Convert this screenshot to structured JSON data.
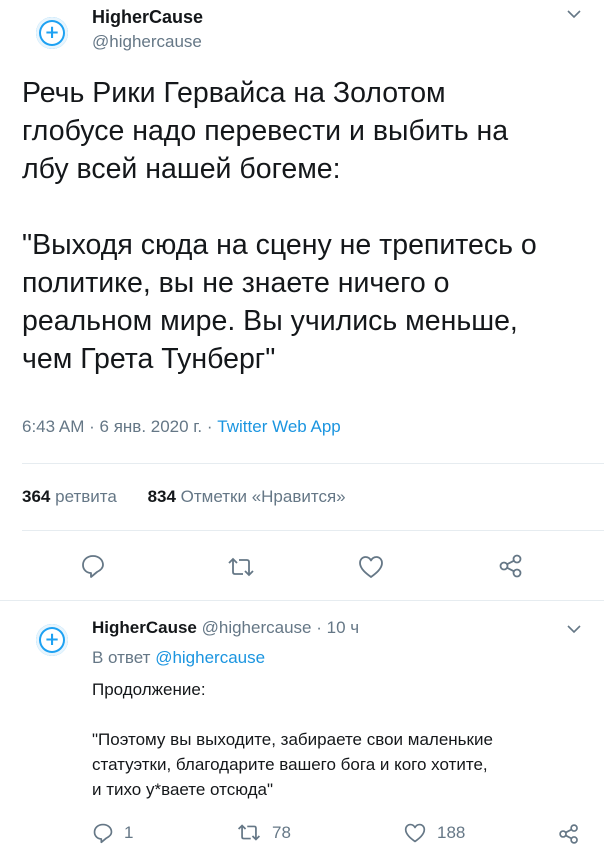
{
  "tweet": {
    "display_name": "HigherCause",
    "handle": "@highercause",
    "text": "Речь Рики Гервайса на Золотом\nглобусе надо перевести и выбить на\nлбу всей нашей богеме:\n\n\"Выходя сюда на сцену не трепитесь о\nполитике, вы не знаете ничего о\nреальном мире. Вы учились меньше,\nчем Грета Тунберг\"",
    "time": "6:43 AM",
    "date": "6 янв. 2020 г.",
    "source": "Twitter Web App",
    "retweets_count": "364",
    "retweets_label": "ретвита",
    "likes_count": "834",
    "likes_label": "Отметки «Нравится»"
  },
  "reply": {
    "display_name": "HigherCause",
    "handle": "@highercause",
    "age": "10 ч",
    "replying_prefix": "В ответ",
    "replying_to": "@highercause",
    "text": "Продолжение:\n\n\"Поэтому вы выходите, забираете свои маленькие\nстатуэтки, благодарите вашего бога и кого хотите,\nи тихо у*ваете отсюда\"",
    "reply_count": "1",
    "retweet_count": "78",
    "like_count": "188"
  },
  "separators": {
    "dot": "·"
  },
  "icons": {
    "avatar": "plus-icon",
    "menu": "chevron-down-icon",
    "reply": "comment-icon",
    "retweet": "retweet-icon",
    "like": "heart-icon",
    "share": "share-icon"
  },
  "colors": {
    "accent": "#1da1f2",
    "link": "#1b95e0",
    "muted": "#657786",
    "text": "#14171a",
    "divider": "#e6ecf0"
  }
}
